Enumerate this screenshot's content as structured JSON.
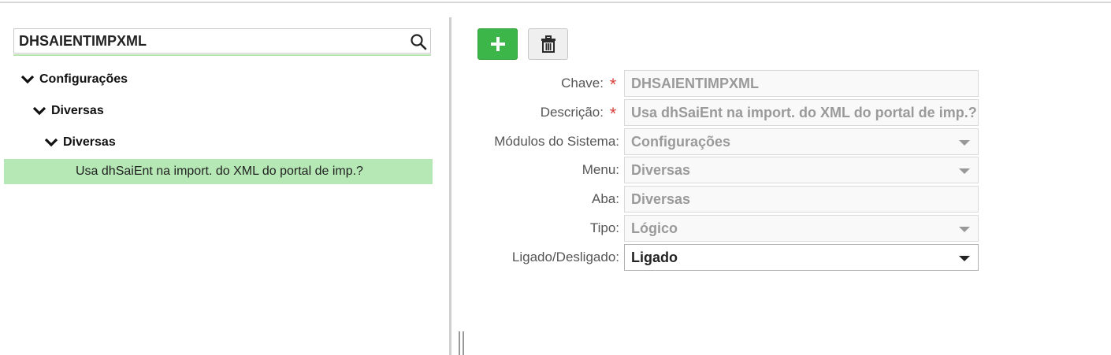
{
  "search": {
    "value": "DHSAIENTIMPXML"
  },
  "tree": {
    "level1": "Configurações",
    "level2": "Diversas",
    "level3": "Diversas",
    "leaf": "Usa dhSaiEnt na import. do XML do portal de imp.?"
  },
  "toolbar": {
    "add_icon": "plus-icon",
    "delete_icon": "trash-icon"
  },
  "form": {
    "chave": {
      "label": "Chave:",
      "required": "*",
      "value": "DHSAIENTIMPXML"
    },
    "descricao": {
      "label": "Descrição:",
      "required": "*",
      "value": "Usa dhSaiEnt na import. do XML do portal de imp.?"
    },
    "modulos": {
      "label": "Módulos do Sistema:",
      "value": "Configurações"
    },
    "menu": {
      "label": "Menu:",
      "value": "Diversas"
    },
    "aba": {
      "label": "Aba:",
      "value": "Diversas"
    },
    "tipo": {
      "label": "Tipo:",
      "value": "Lógico"
    },
    "ligado": {
      "label": "Ligado/Desligado:",
      "value": "Ligado"
    }
  },
  "colors": {
    "accent_green": "#3cb648",
    "selection_green": "#b5e8b5",
    "required_red": "#d9413a"
  }
}
